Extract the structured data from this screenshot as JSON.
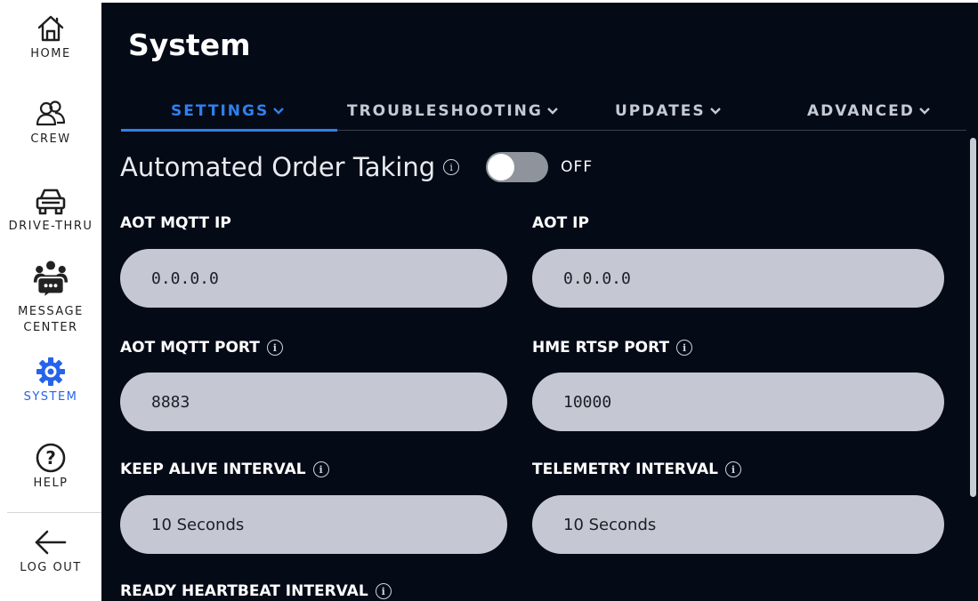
{
  "sidebar": {
    "items": [
      {
        "label": "HOME",
        "icon": "home-icon"
      },
      {
        "label": "CREW",
        "icon": "crew-icon"
      },
      {
        "label": "DRIVE-THRU",
        "icon": "car-icon"
      },
      {
        "label": "MESSAGE CENTER",
        "icon": "message-center-icon"
      },
      {
        "label": "SYSTEM",
        "icon": "gear-icon",
        "active": true
      },
      {
        "label": "HELP",
        "icon": "help-icon"
      },
      {
        "label": "LOG OUT",
        "icon": "arrow-left-icon"
      }
    ]
  },
  "page": {
    "title": "System"
  },
  "tabs": [
    {
      "label": "SETTINGS",
      "active": true
    },
    {
      "label": "TROUBLESHOOTING"
    },
    {
      "label": "UPDATES"
    },
    {
      "label": "ADVANCED"
    }
  ],
  "aot": {
    "title": "Automated Order Taking",
    "toggle_state": "OFF",
    "enabled": false
  },
  "fields": {
    "aot_mqtt_ip": {
      "label": "AOT MQTT IP",
      "value": "0.0.0.0"
    },
    "aot_ip": {
      "label": "AOT IP",
      "value": "0.0.0.0"
    },
    "aot_mqtt_port": {
      "label": "AOT MQTT PORT",
      "value": "8883"
    },
    "hme_rtsp_port": {
      "label": "HME RTSP PORT",
      "value": "10000"
    },
    "keep_alive_interval": {
      "label": "KEEP ALIVE INTERVAL",
      "value": "10 Seconds"
    },
    "telemetry_interval": {
      "label": "TELEMETRY INTERVAL",
      "value": "10 Seconds"
    },
    "ready_heartbeat_interval": {
      "label": "READY HEARTBEAT INTERVAL"
    }
  },
  "colors": {
    "accent": "#2f80ed",
    "background": "#050a17",
    "field": "#c5c8d2",
    "sidebar_active": "#2563eb"
  }
}
